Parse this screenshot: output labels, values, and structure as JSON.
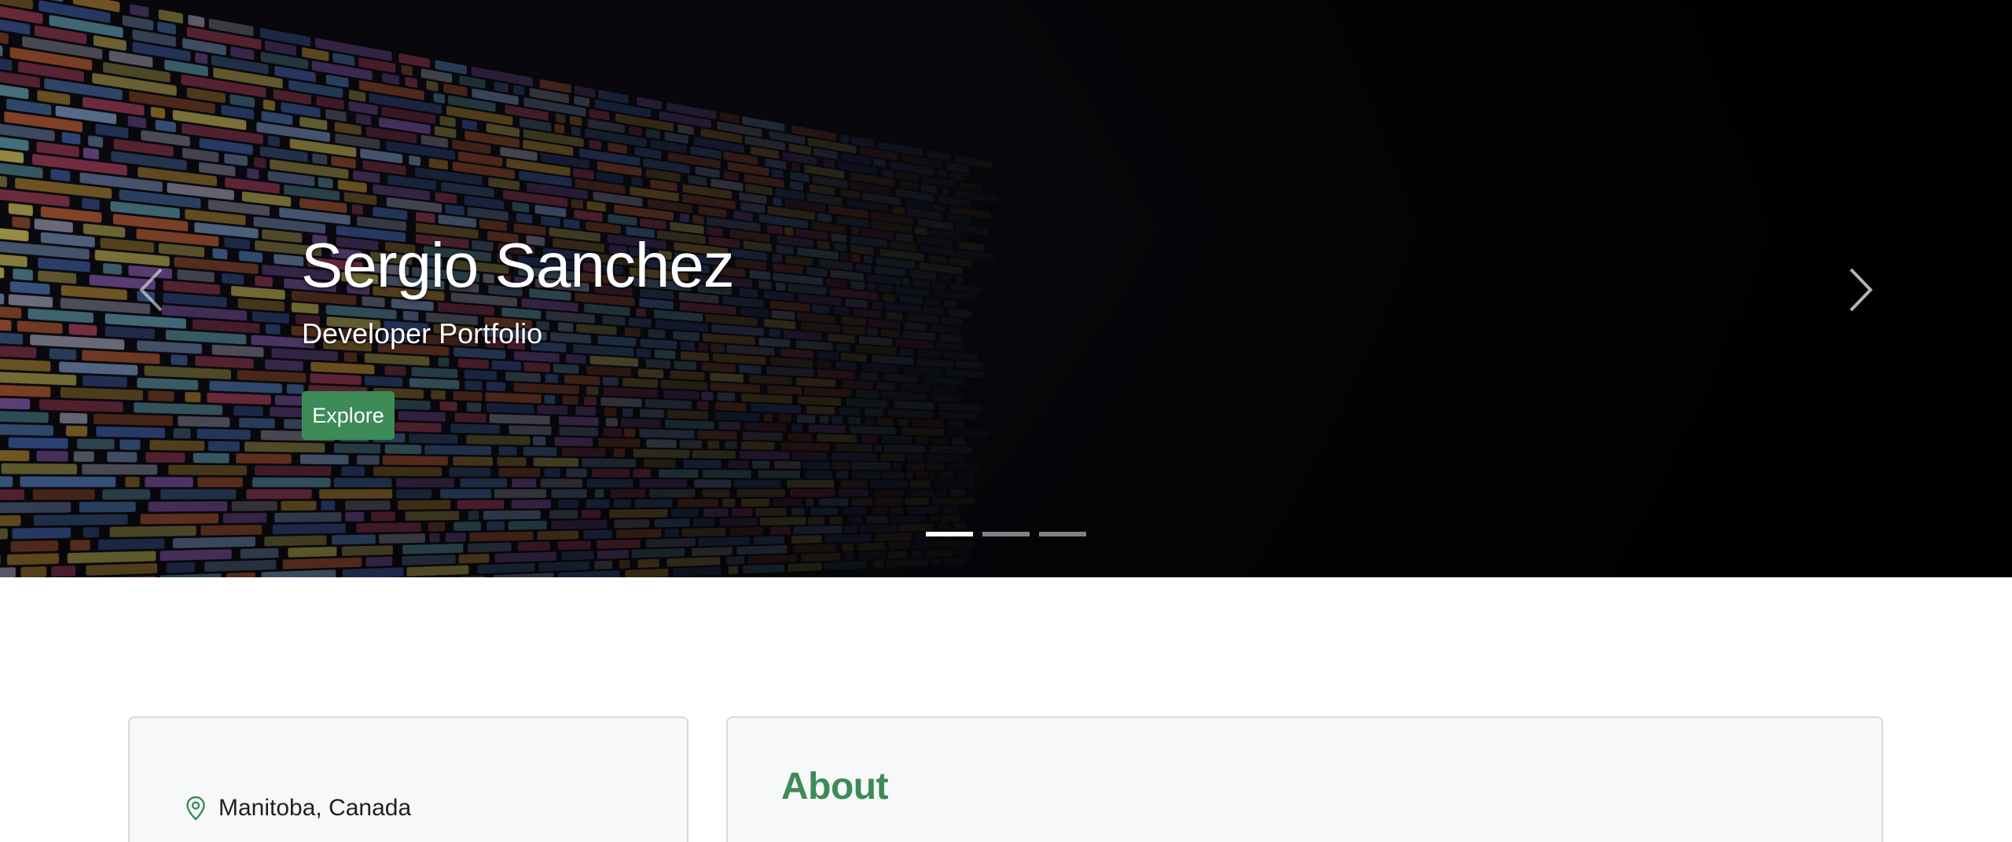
{
  "hero": {
    "title": "Sergio Sanchez",
    "subtitle": "Developer Portfolio",
    "cta_label": "Explore",
    "prev_icon": "chevron-left-icon",
    "next_icon": "chevron-right-icon",
    "slide_count": 3,
    "active_slide": 1,
    "accent_color": "#3d8b57"
  },
  "contact": {
    "location": "Manitoba, Canada",
    "location_icon": "map-pin-icon"
  },
  "about": {
    "title": "About"
  }
}
